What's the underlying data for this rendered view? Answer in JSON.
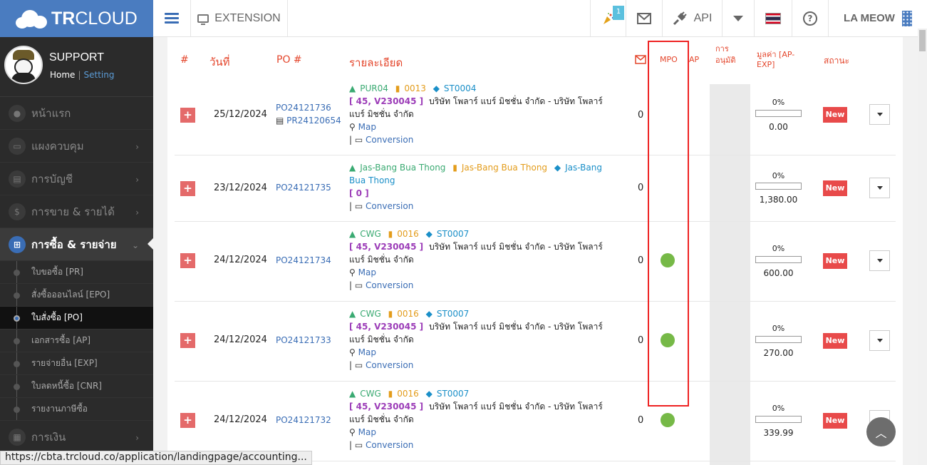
{
  "brand": {
    "name_bold": "TR",
    "name_light": "CLOUD"
  },
  "topbar": {
    "extension_label": "EXTENSION",
    "notification_count": "1",
    "api_label": "API",
    "user_label": "LA MEOW"
  },
  "profile": {
    "name": "SUPPORT",
    "home": "Home",
    "separator": "|",
    "setting": "Setting"
  },
  "sidebar": {
    "items": [
      {
        "label": "หน้าแรก"
      },
      {
        "label": "แผงควบคุม"
      },
      {
        "label": "การบัญชี"
      },
      {
        "label": "การขาย & รายได้"
      },
      {
        "label": "การซื้อ & รายจ่าย"
      },
      {
        "label": "การเงิน"
      }
    ],
    "sub_items": [
      {
        "label": "ใบขอซื้อ [PR]"
      },
      {
        "label": "สั่งซื้อออนไลน์ [EPO]"
      },
      {
        "label": "ใบสั่งซื้อ [PO]"
      },
      {
        "label": "เอกสารซื้อ [AP]"
      },
      {
        "label": "รายจ่ายอื่น [EXP]"
      },
      {
        "label": "ใบลดหนี้ซื้อ [CNR]"
      },
      {
        "label": "รายงานภาษีซื้อ"
      }
    ]
  },
  "table": {
    "headers": {
      "num": "#",
      "date": "วันที่",
      "po": "PO #",
      "detail": "รายละเอียด",
      "mpo": "MPO",
      "ap": "AP",
      "approve1": "การ",
      "approve2": "อนุมัติ",
      "value1": "มูลค่า [AP-",
      "value2": "EXP]",
      "status": "สถานะ"
    },
    "rows": [
      {
        "date": "25/12/2024",
        "po": "PO24121736",
        "po2": "PR24120654",
        "tag_user": "PUR04",
        "tag_bld": "0013",
        "tag_box": "ST0004",
        "vendor_code": "[ 45, V230045 ]",
        "vendor_line1": "บริษัท โพลาร์ แบร์ มิชชั่น จำกัด - บริษัท โพลาร์",
        "vendor_line2": "แบร์ มิชชั่น จำกัด",
        "map": "Map",
        "conversion": "Conversion",
        "count": "0",
        "mpo": false,
        "pct": "0%",
        "progress": 0,
        "amount": "0.00",
        "status": "New"
      },
      {
        "date": "23/12/2024",
        "po": "PO24121735",
        "po2": "",
        "tag_user": "Jas-Bang Bua Thong",
        "tag_bld": "Jas-Bang Bua Thong",
        "tag_box": "Jas-Bang",
        "tag_box2": "Bua Thong",
        "vendor_code": "[ 0 ]",
        "vendor_line1": "",
        "vendor_line2": "",
        "map": "",
        "conversion": "Conversion",
        "count": "0",
        "mpo": false,
        "pct": "0%",
        "progress": 0,
        "amount": "1,380.00",
        "status": "New"
      },
      {
        "date": "24/12/2024",
        "po": "PO24121734",
        "po2": "",
        "tag_user": "CWG",
        "tag_bld": "0016",
        "tag_box": "ST0007",
        "vendor_code": "[ 45, V230045 ]",
        "vendor_line1": "บริษัท โพลาร์ แบร์ มิชชั่น จำกัด - บริษัท โพลาร์",
        "vendor_line2": "แบร์ มิชชั่น จำกัด",
        "map": "Map",
        "conversion": "Conversion",
        "count": "0",
        "mpo": true,
        "pct": "0%",
        "progress": 0,
        "amount": "600.00",
        "status": "New"
      },
      {
        "date": "24/12/2024",
        "po": "PO24121733",
        "po2": "",
        "tag_user": "CWG",
        "tag_bld": "0016",
        "tag_box": "ST0007",
        "vendor_code": "[ 45, V230045 ]",
        "vendor_line1": "บริษัท โพลาร์ แบร์ มิชชั่น จำกัด - บริษัท โพลาร์",
        "vendor_line2": "แบร์ มิชชั่น จำกัด",
        "map": "Map",
        "conversion": "Conversion",
        "count": "0",
        "mpo": true,
        "pct": "0%",
        "progress": 0,
        "amount": "270.00",
        "status": "New"
      },
      {
        "date": "24/12/2024",
        "po": "PO24121732",
        "po2": "",
        "tag_user": "CWG",
        "tag_bld": "0016",
        "tag_box": "ST0007",
        "vendor_code": "[ 45, V230045 ]",
        "vendor_line1": "บริษัท โพลาร์ แบร์ มิชชั่น จำกัด - บริษัท โพลาร์",
        "vendor_line2": "แบร์ มิชชั่น จำกัด",
        "map": "Map",
        "conversion": "Conversion",
        "count": "0",
        "mpo": true,
        "pct": "0%",
        "progress": 0,
        "amount": "339.99",
        "status": "New"
      }
    ]
  },
  "statusbar": {
    "url": "https://cbta.trcloud.co/application/landingpage/accounting..."
  },
  "colors": {
    "brand_blue": "#4a7cc0",
    "header_red": "#e4462c",
    "status_red": "#e84a4a",
    "mpo_green": "#76b947"
  }
}
